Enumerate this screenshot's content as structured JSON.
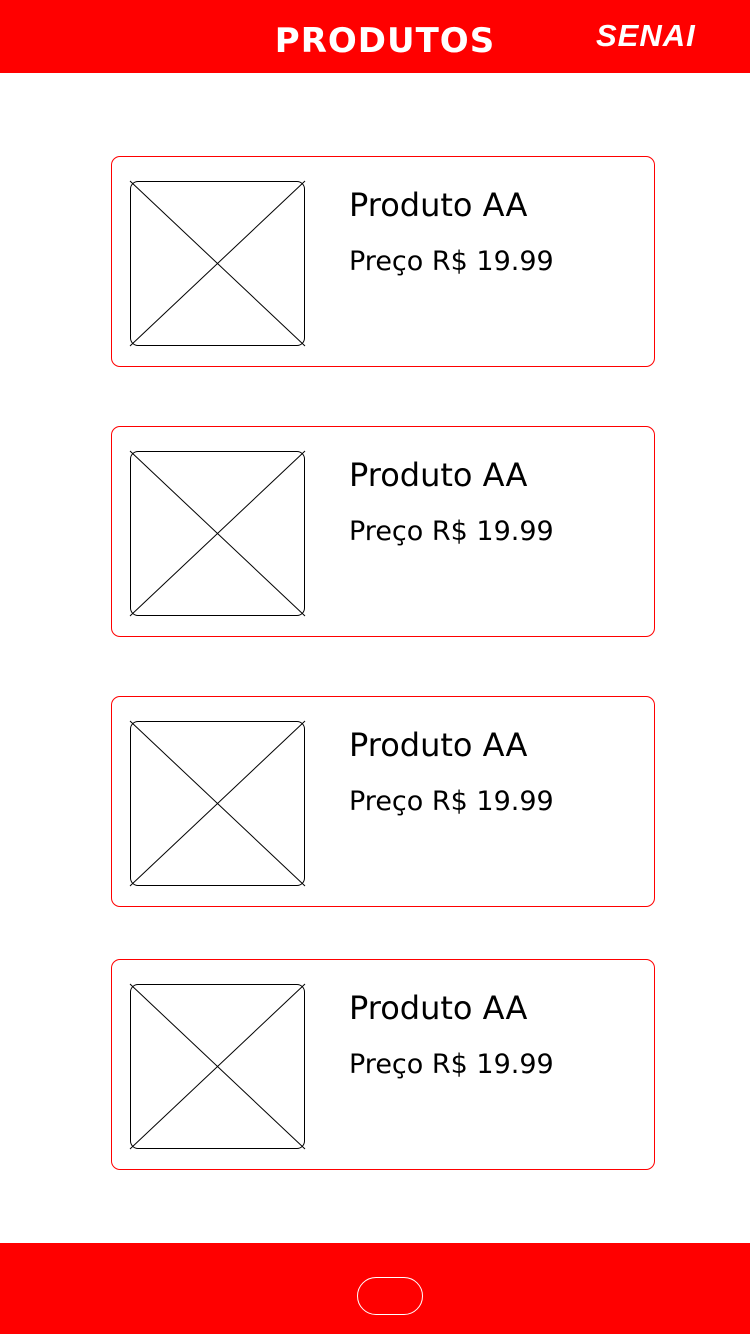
{
  "header": {
    "title": "PRODUTOS",
    "brand": "SENAI"
  },
  "products": [
    {
      "name": "Produto AA",
      "price": "Preço R$ 19.99"
    },
    {
      "name": "Produto AA",
      "price": "Preço R$ 19.99"
    },
    {
      "name": "Produto AA",
      "price": "Preço R$ 19.99"
    },
    {
      "name": "Produto AA",
      "price": "Preço R$ 19.99"
    }
  ],
  "colors": {
    "accent": "#ff0000",
    "card_border": "#ff0000",
    "text": "#000000",
    "header_text": "#ffffff"
  },
  "icons": {
    "image_placeholder": "image-placeholder-icon"
  }
}
